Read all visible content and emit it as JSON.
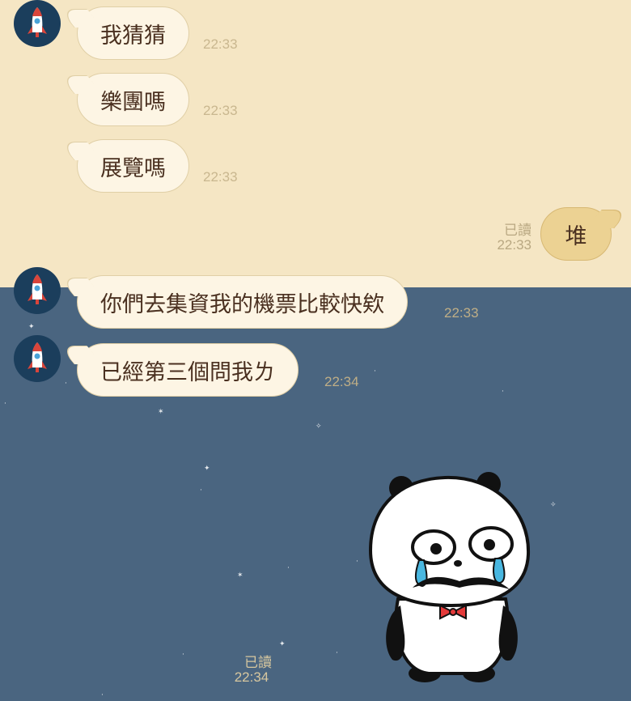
{
  "messages": [
    {
      "sender": "other",
      "text": "我猜猜",
      "time": "22:33"
    },
    {
      "sender": "other",
      "text": "樂團嗎",
      "time": "22:33"
    },
    {
      "sender": "other",
      "text": "展覽嗎",
      "time": "22:33"
    },
    {
      "sender": "me",
      "text": "堆",
      "read": "已讀",
      "time": "22:33"
    },
    {
      "sender": "other",
      "text": "你們去集資我的機票比較快欸",
      "time": "22:33"
    },
    {
      "sender": "other",
      "text": "已經第三個問我ㄌ",
      "time": "22:34"
    },
    {
      "sender": "me",
      "sticker": "crying-panda-sticker",
      "read": "已讀",
      "time": "22:34"
    }
  ],
  "avatar_icon": "rocket-icon",
  "colors": {
    "background_top": "#f5e6c4",
    "background_bottom": "#4a6580",
    "incoming_bubble": "#fdf5e4",
    "outgoing_bubble": "#ecd293",
    "avatar_bg": "#1b3e5c"
  }
}
